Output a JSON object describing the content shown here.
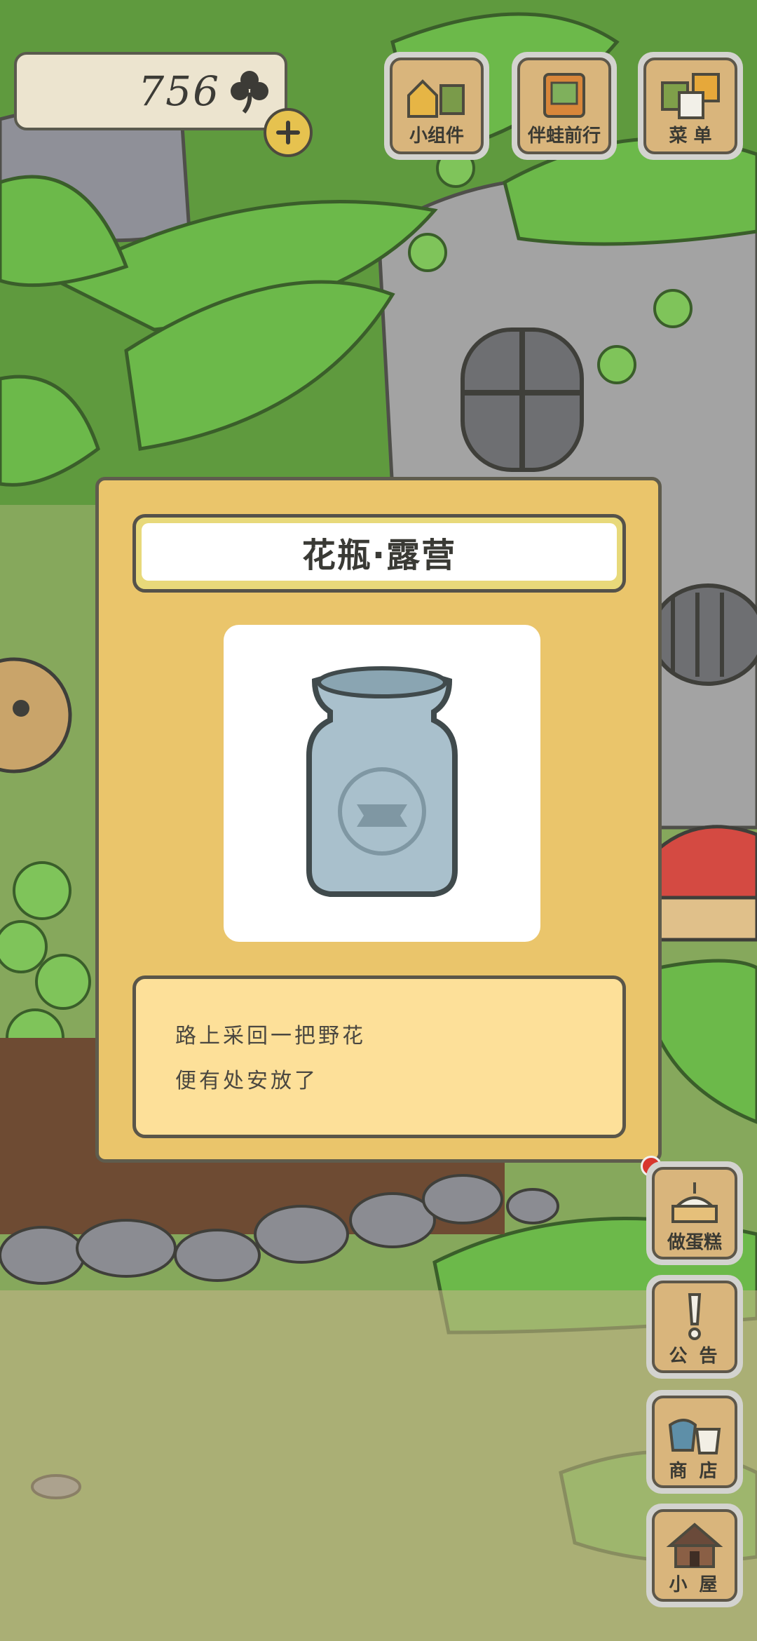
{
  "hud": {
    "clover_count": "756",
    "buttons": {
      "widgets": "小组件",
      "travel": "伴蛙前行",
      "menu": "菜 单"
    }
  },
  "side_buttons": {
    "cake": "做蛋糕",
    "notice": "公 告",
    "shop": "商 店",
    "house": "小 屋"
  },
  "item_popup": {
    "title": "花瓶·露营",
    "description": [
      "路上采回一把野花",
      "便有处安放了"
    ]
  },
  "colors": {
    "panel": "#eac56b",
    "desc_bg": "#fde099",
    "title_border": "#e8d97a",
    "button_wood": "#d9b57c",
    "badge": "#d8362e"
  }
}
